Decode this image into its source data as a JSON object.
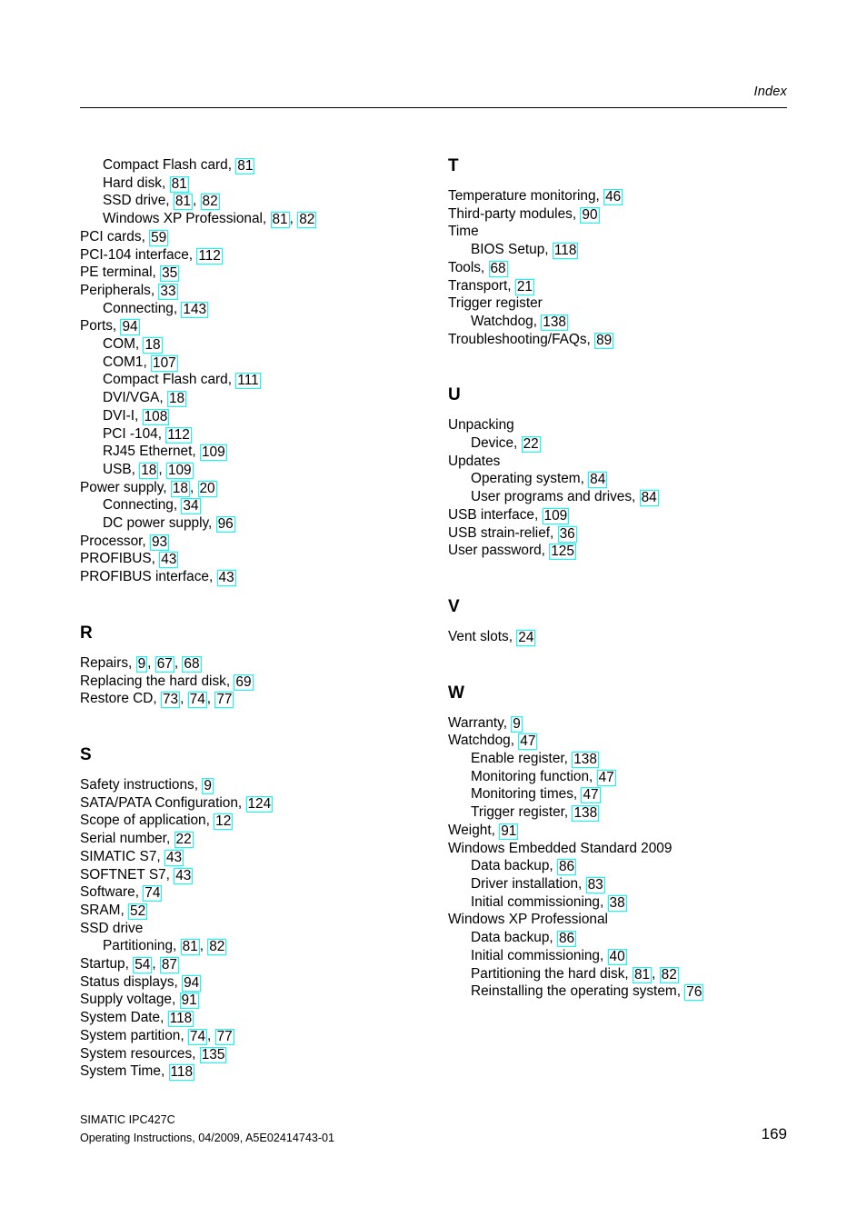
{
  "header": {
    "title": "Index"
  },
  "columns": {
    "left": [
      {
        "letter": "",
        "entries": [
          {
            "level": 1,
            "text": "Compact Flash card,",
            "pages": [
              "81"
            ]
          },
          {
            "level": 1,
            "text": "Hard disk,",
            "pages": [
              "81"
            ]
          },
          {
            "level": 1,
            "text": "SSD drive,",
            "pages": [
              "81",
              "82"
            ]
          },
          {
            "level": 1,
            "text": "Windows XP Professional,",
            "pages": [
              "81",
              "82"
            ]
          },
          {
            "level": 0,
            "text": "PCI cards,",
            "pages": [
              "59"
            ]
          },
          {
            "level": 0,
            "text": "PCI-104 interface,",
            "pages": [
              "112"
            ]
          },
          {
            "level": 0,
            "text": "PE terminal,",
            "pages": [
              "35"
            ]
          },
          {
            "level": 0,
            "text": "Peripherals,",
            "pages": [
              "33"
            ]
          },
          {
            "level": 1,
            "text": "Connecting,",
            "pages": [
              "143"
            ]
          },
          {
            "level": 0,
            "text": "Ports,",
            "pages": [
              "94"
            ]
          },
          {
            "level": 1,
            "text": "COM,",
            "pages": [
              "18"
            ]
          },
          {
            "level": 1,
            "text": "COM1,",
            "pages": [
              "107"
            ]
          },
          {
            "level": 1,
            "text": "Compact Flash card,",
            "pages": [
              "111"
            ]
          },
          {
            "level": 1,
            "text": "DVI/VGA,",
            "pages": [
              "18"
            ]
          },
          {
            "level": 1,
            "text": "DVI-I,",
            "pages": [
              "108"
            ]
          },
          {
            "level": 1,
            "text": "PCI -104,",
            "pages": [
              "112"
            ]
          },
          {
            "level": 1,
            "text": "RJ45 Ethernet,",
            "pages": [
              "109"
            ]
          },
          {
            "level": 1,
            "text": "USB,",
            "pages": [
              "18",
              "109"
            ]
          },
          {
            "level": 0,
            "text": "Power supply,",
            "pages": [
              "18",
              "20"
            ]
          },
          {
            "level": 1,
            "text": "Connecting,",
            "pages": [
              "34"
            ]
          },
          {
            "level": 1,
            "text": "DC power supply,",
            "pages": [
              "96"
            ]
          },
          {
            "level": 0,
            "text": "Processor,",
            "pages": [
              "93"
            ]
          },
          {
            "level": 0,
            "text": "PROFIBUS,",
            "pages": [
              "43"
            ]
          },
          {
            "level": 0,
            "text": "PROFIBUS interface,",
            "pages": [
              "43"
            ]
          }
        ]
      },
      {
        "letter": "R",
        "entries": [
          {
            "level": 0,
            "text": "Repairs,",
            "pages": [
              "9",
              "67",
              "68"
            ]
          },
          {
            "level": 0,
            "text": "Replacing the hard disk,",
            "pages": [
              "69"
            ]
          },
          {
            "level": 0,
            "text": "Restore CD,",
            "pages": [
              "73",
              "74",
              "77"
            ]
          }
        ]
      },
      {
        "letter": "S",
        "entries": [
          {
            "level": 0,
            "text": "Safety instructions,",
            "pages": [
              "9"
            ]
          },
          {
            "level": 0,
            "text": "SATA/PATA Configuration,",
            "pages": [
              "124"
            ]
          },
          {
            "level": 0,
            "text": "Scope of application,",
            "pages": [
              "12"
            ]
          },
          {
            "level": 0,
            "text": "Serial number,",
            "pages": [
              "22"
            ]
          },
          {
            "level": 0,
            "text": "SIMATIC S7,",
            "pages": [
              "43"
            ]
          },
          {
            "level": 0,
            "text": "SOFTNET S7,",
            "pages": [
              "43"
            ]
          },
          {
            "level": 0,
            "text": "Software,",
            "pages": [
              "74"
            ]
          },
          {
            "level": 0,
            "text": "SRAM,",
            "pages": [
              "52"
            ]
          },
          {
            "level": 0,
            "text": "SSD drive",
            "pages": []
          },
          {
            "level": 1,
            "text": "Partitioning,",
            "pages": [
              "81",
              "82"
            ]
          },
          {
            "level": 0,
            "text": "Startup,",
            "pages": [
              "54",
              "87"
            ]
          },
          {
            "level": 0,
            "text": "Status displays,",
            "pages": [
              "94"
            ]
          },
          {
            "level": 0,
            "text": "Supply voltage,",
            "pages": [
              "91"
            ]
          },
          {
            "level": 0,
            "text": "System Date,",
            "pages": [
              "118"
            ]
          },
          {
            "level": 0,
            "text": "System partition,",
            "pages": [
              "74",
              "77"
            ]
          },
          {
            "level": 0,
            "text": "System resources,",
            "pages": [
              "135"
            ]
          },
          {
            "level": 0,
            "text": "System Time,",
            "pages": [
              "118"
            ]
          }
        ]
      }
    ],
    "right": [
      {
        "letter": "T",
        "entries": [
          {
            "level": 0,
            "text": "Temperature monitoring,",
            "pages": [
              "46"
            ]
          },
          {
            "level": 0,
            "text": "Third-party modules,",
            "pages": [
              "90"
            ]
          },
          {
            "level": 0,
            "text": "Time",
            "pages": []
          },
          {
            "level": 1,
            "text": "BIOS Setup,",
            "pages": [
              "118"
            ]
          },
          {
            "level": 0,
            "text": "Tools,",
            "pages": [
              "68"
            ]
          },
          {
            "level": 0,
            "text": "Transport,",
            "pages": [
              "21"
            ]
          },
          {
            "level": 0,
            "text": "Trigger register",
            "pages": []
          },
          {
            "level": 1,
            "text": "Watchdog,",
            "pages": [
              "138"
            ]
          },
          {
            "level": 0,
            "text": "Troubleshooting/FAQs,",
            "pages": [
              "89"
            ]
          }
        ]
      },
      {
        "letter": "U",
        "entries": [
          {
            "level": 0,
            "text": "Unpacking",
            "pages": []
          },
          {
            "level": 1,
            "text": "Device,",
            "pages": [
              "22"
            ]
          },
          {
            "level": 0,
            "text": "Updates",
            "pages": []
          },
          {
            "level": 1,
            "text": "Operating system,",
            "pages": [
              "84"
            ]
          },
          {
            "level": 1,
            "text": "User programs and drives,",
            "pages": [
              "84"
            ]
          },
          {
            "level": 0,
            "text": "USB interface,",
            "pages": [
              "109"
            ]
          },
          {
            "level": 0,
            "text": "USB strain-relief,",
            "pages": [
              "36"
            ]
          },
          {
            "level": 0,
            "text": "User password,",
            "pages": [
              "125"
            ]
          }
        ]
      },
      {
        "letter": "V",
        "entries": [
          {
            "level": 0,
            "text": "Vent slots,",
            "pages": [
              "24"
            ]
          }
        ]
      },
      {
        "letter": "W",
        "entries": [
          {
            "level": 0,
            "text": "Warranty,",
            "pages": [
              "9"
            ]
          },
          {
            "level": 0,
            "text": "Watchdog,",
            "pages": [
              "47"
            ]
          },
          {
            "level": 1,
            "text": "Enable register,",
            "pages": [
              "138"
            ]
          },
          {
            "level": 1,
            "text": "Monitoring function,",
            "pages": [
              "47"
            ]
          },
          {
            "level": 1,
            "text": "Monitoring times,",
            "pages": [
              "47"
            ]
          },
          {
            "level": 1,
            "text": "Trigger register,",
            "pages": [
              "138"
            ]
          },
          {
            "level": 0,
            "text": "Weight,",
            "pages": [
              "91"
            ]
          },
          {
            "level": 0,
            "text": "Windows Embedded Standard 2009",
            "pages": []
          },
          {
            "level": 1,
            "text": "Data backup,",
            "pages": [
              "86"
            ]
          },
          {
            "level": 1,
            "text": "Driver installation,",
            "pages": [
              "83"
            ]
          },
          {
            "level": 1,
            "text": "Initial commissioning,",
            "pages": [
              "38"
            ]
          },
          {
            "level": 0,
            "text": "Windows XP Professional",
            "pages": []
          },
          {
            "level": 1,
            "text": "Data backup,",
            "pages": [
              "86"
            ]
          },
          {
            "level": 1,
            "text": "Initial commissioning,",
            "pages": [
              "40"
            ]
          },
          {
            "level": 1,
            "text": "Partitioning the hard disk,",
            "pages": [
              "81",
              "82"
            ]
          },
          {
            "level": 1,
            "text": "Reinstalling the operating system,",
            "pages": [
              "76"
            ]
          }
        ]
      }
    ]
  },
  "footer": {
    "line1": "SIMATIC IPC427C",
    "line2": "Operating Instructions, 04/2009, A5E02414743-01",
    "page_number": "169"
  },
  "colors": {
    "page_background": "#ffffff",
    "text": "#000000",
    "pageref_outline": "#00ffff",
    "rule": "#000000"
  }
}
